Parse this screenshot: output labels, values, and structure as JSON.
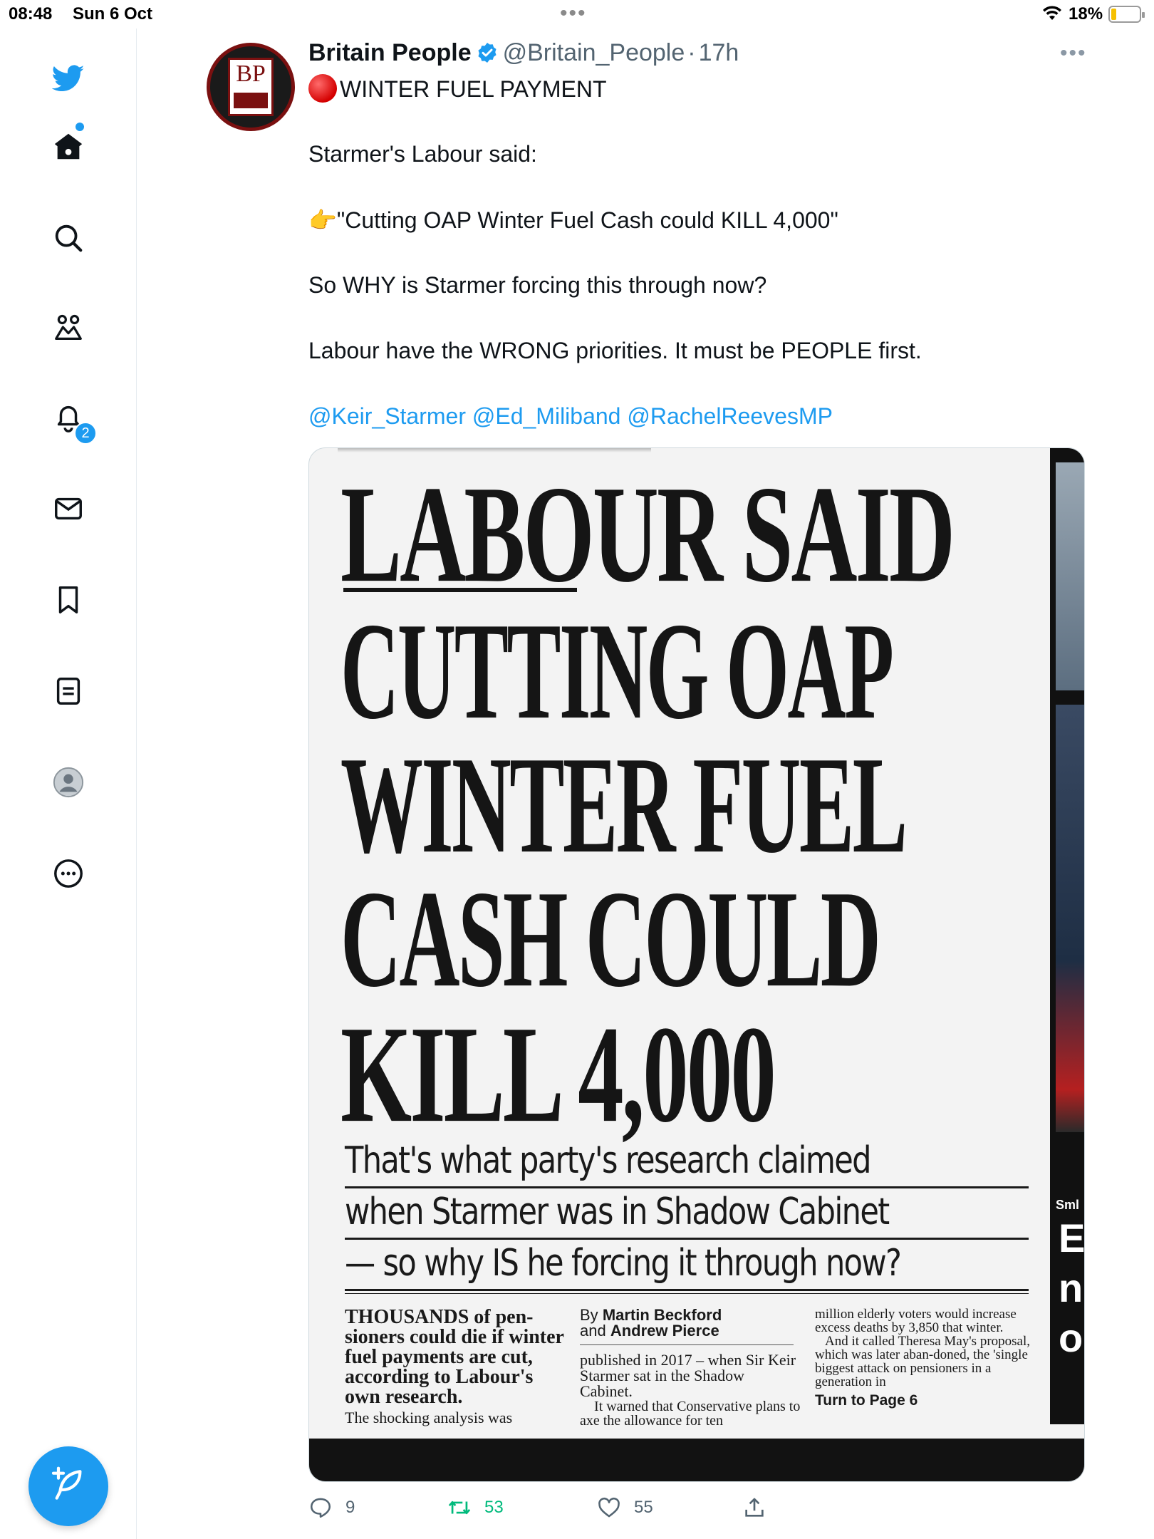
{
  "status_bar": {
    "time": "08:48",
    "date": "Sun 6 Oct",
    "battery_percent": "18%",
    "battery_level": 0.18
  },
  "sidebar": {
    "items": [
      {
        "name": "twitter-logo",
        "icon": "twitter-bird-icon"
      },
      {
        "name": "home",
        "icon": "home-icon",
        "has_dot": true
      },
      {
        "name": "explore",
        "icon": "search-icon"
      },
      {
        "name": "communities",
        "icon": "people-icon"
      },
      {
        "name": "notifications",
        "icon": "bell-icon",
        "badge": "2"
      },
      {
        "name": "messages",
        "icon": "mail-icon"
      },
      {
        "name": "bookmarks",
        "icon": "bookmark-icon"
      },
      {
        "name": "lists",
        "icon": "list-icon"
      },
      {
        "name": "profile",
        "icon": "avatar-icon"
      },
      {
        "name": "more",
        "icon": "more-circle-icon"
      }
    ],
    "compose_icon": "compose-feather-icon",
    "accent_color": "#1d9bf0"
  },
  "tweet": {
    "author_name": "Britain People",
    "author_handle": "@Britain_People",
    "separator": "·",
    "time_ago": "17h",
    "avatar_text": "BP",
    "lines": {
      "title": "WINTER FUEL PAYMENT",
      "l1": "Starmer's Labour said:",
      "l2_emoji": "👉",
      "l2": "\"Cutting OAP Winter Fuel Cash could KILL 4,000\"",
      "l3": "So WHY is Starmer forcing this through now?",
      "l4": "Labour have the WRONG priorities. It must be PEOPLE first."
    },
    "mentions": "@Keir_Starmer @Ed_Miliband @RachelReevesMP",
    "media": {
      "headline": [
        "LABOUR SAID",
        "CUTTING OAP",
        "WINTER FUEL",
        "CASH COULD",
        "KILL 4,000"
      ],
      "subhead": [
        "That's what party's research claimed",
        "when Starmer was in Shadow Cabinet",
        "— so why IS he forcing it through now?"
      ],
      "col1_bold": "THOUSANDS of pen-sioners could die if winter fuel payments are cut, according to Labour's own research.",
      "col1_normal": "The shocking analysis was",
      "col2_byline_prefix1": "By",
      "col2_author1": "Martin Beckford",
      "col2_byline_prefix2": "and",
      "col2_author2": "Andrew Pierce",
      "col2_text1": "published in 2017 – when Sir Keir Starmer sat in the Shadow Cabinet.",
      "col2_text2": "It warned that Conservative plans to axe the allowance for ten",
      "col3_text1": "million elderly voters would increase excess deaths by 3,850 that winter.",
      "col3_text2": "And it called Theresa May's proposal, which was later aban-doned, the 'single biggest attack on pensioners in a generation in",
      "col3_turn": "Turn to Page 6",
      "side_label": "Sml",
      "side_letters": [
        "E",
        "n",
        "o"
      ]
    },
    "actions": {
      "replies": "9",
      "retweets": "53",
      "likes": "55"
    },
    "retweet_color": "#00ba7c"
  }
}
